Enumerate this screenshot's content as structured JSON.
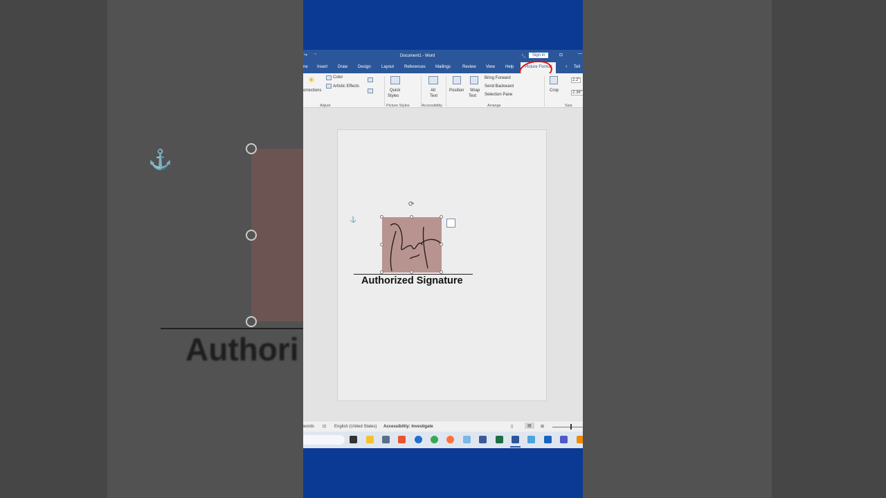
{
  "background": {
    "zoomed_text": "Authori"
  },
  "window": {
    "title": "Document1 - Word",
    "sign_in": "Sign in"
  },
  "tabs": [
    "ne",
    "Insert",
    "Draw",
    "Design",
    "Layout",
    "References",
    "Mailings",
    "Review",
    "View",
    "Help",
    "Picture Format"
  ],
  "tell_me": "Tell",
  "ribbon": {
    "corrections": "orrections",
    "color": "Color",
    "artistic": "Artistic Effects",
    "adjust": "Adjust",
    "quick": "Quick",
    "styles": "Styles",
    "picture_styles": "Picture Styles",
    "alt": "Alt",
    "text": "Text",
    "accessibility": "Accessibility",
    "position": "Position",
    "wrap": "Wrap",
    "wrap_text": "Text",
    "bring": "Bring Forward",
    "send": "Send Backward",
    "selection": "Selection Pane",
    "arrange": "Arrange",
    "crop": "Crop",
    "height": "2.2\"",
    "width": "2.36\"",
    "size": "Size"
  },
  "document": {
    "caption": "Authorized Signature"
  },
  "status": {
    "words": "words",
    "language": "English (United States)",
    "accessibility": "Accessibility: Investigate"
  },
  "taskbar": {
    "apps": [
      "task-view",
      "file-explorer",
      "calculator",
      "office",
      "edge",
      "chrome",
      "firefox",
      "snipping-tool",
      "remote",
      "excel",
      "word",
      "photos",
      "app",
      "teams",
      "vlc"
    ]
  }
}
